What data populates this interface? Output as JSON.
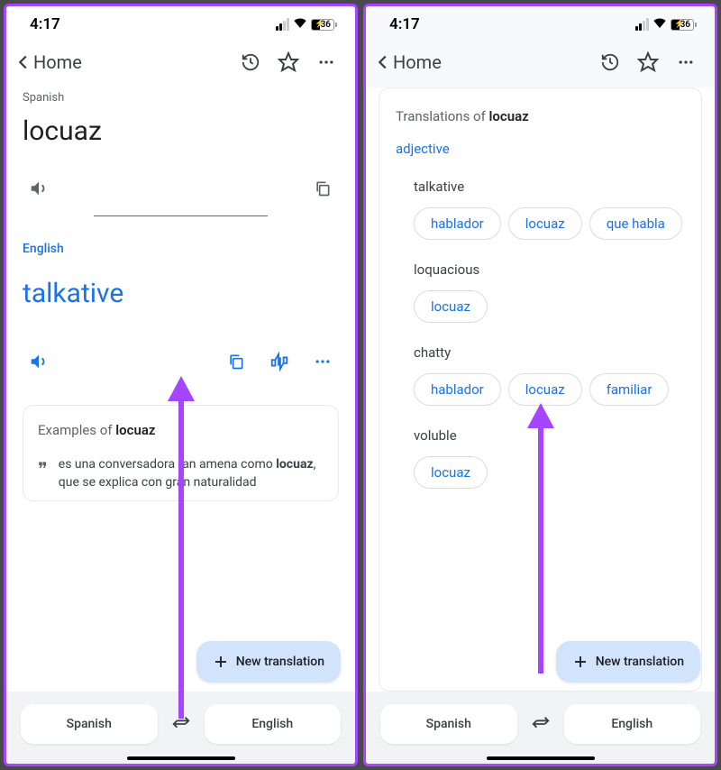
{
  "status": {
    "time": "4:17",
    "battery": "36"
  },
  "nav": {
    "home": "Home"
  },
  "panel1": {
    "src_lang": "Spanish",
    "src_word": "locuaz",
    "tgt_lang": "English",
    "tgt_word": "talkative",
    "examples_label": "Examples of ",
    "examples_word": "locuaz",
    "example_text_a": "es una conversadora tan amena como ",
    "example_bold": "locuaz",
    "example_text_b": ", que se explica con gran naturalidad"
  },
  "panel2": {
    "title_prefix": "Translations of ",
    "title_word": "locuaz",
    "pos": "adjective",
    "groups": [
      {
        "label": "talkative",
        "chips": [
          "hablador",
          "locuaz",
          "que habla"
        ]
      },
      {
        "label": "loquacious",
        "chips": [
          "locuaz"
        ]
      },
      {
        "label": "chatty",
        "chips": [
          "hablador",
          "locuaz",
          "familiar"
        ]
      },
      {
        "label": "voluble",
        "chips": [
          "locuaz"
        ]
      }
    ]
  },
  "fab": "New translation",
  "langbar": {
    "source": "Spanish",
    "target": "English"
  }
}
